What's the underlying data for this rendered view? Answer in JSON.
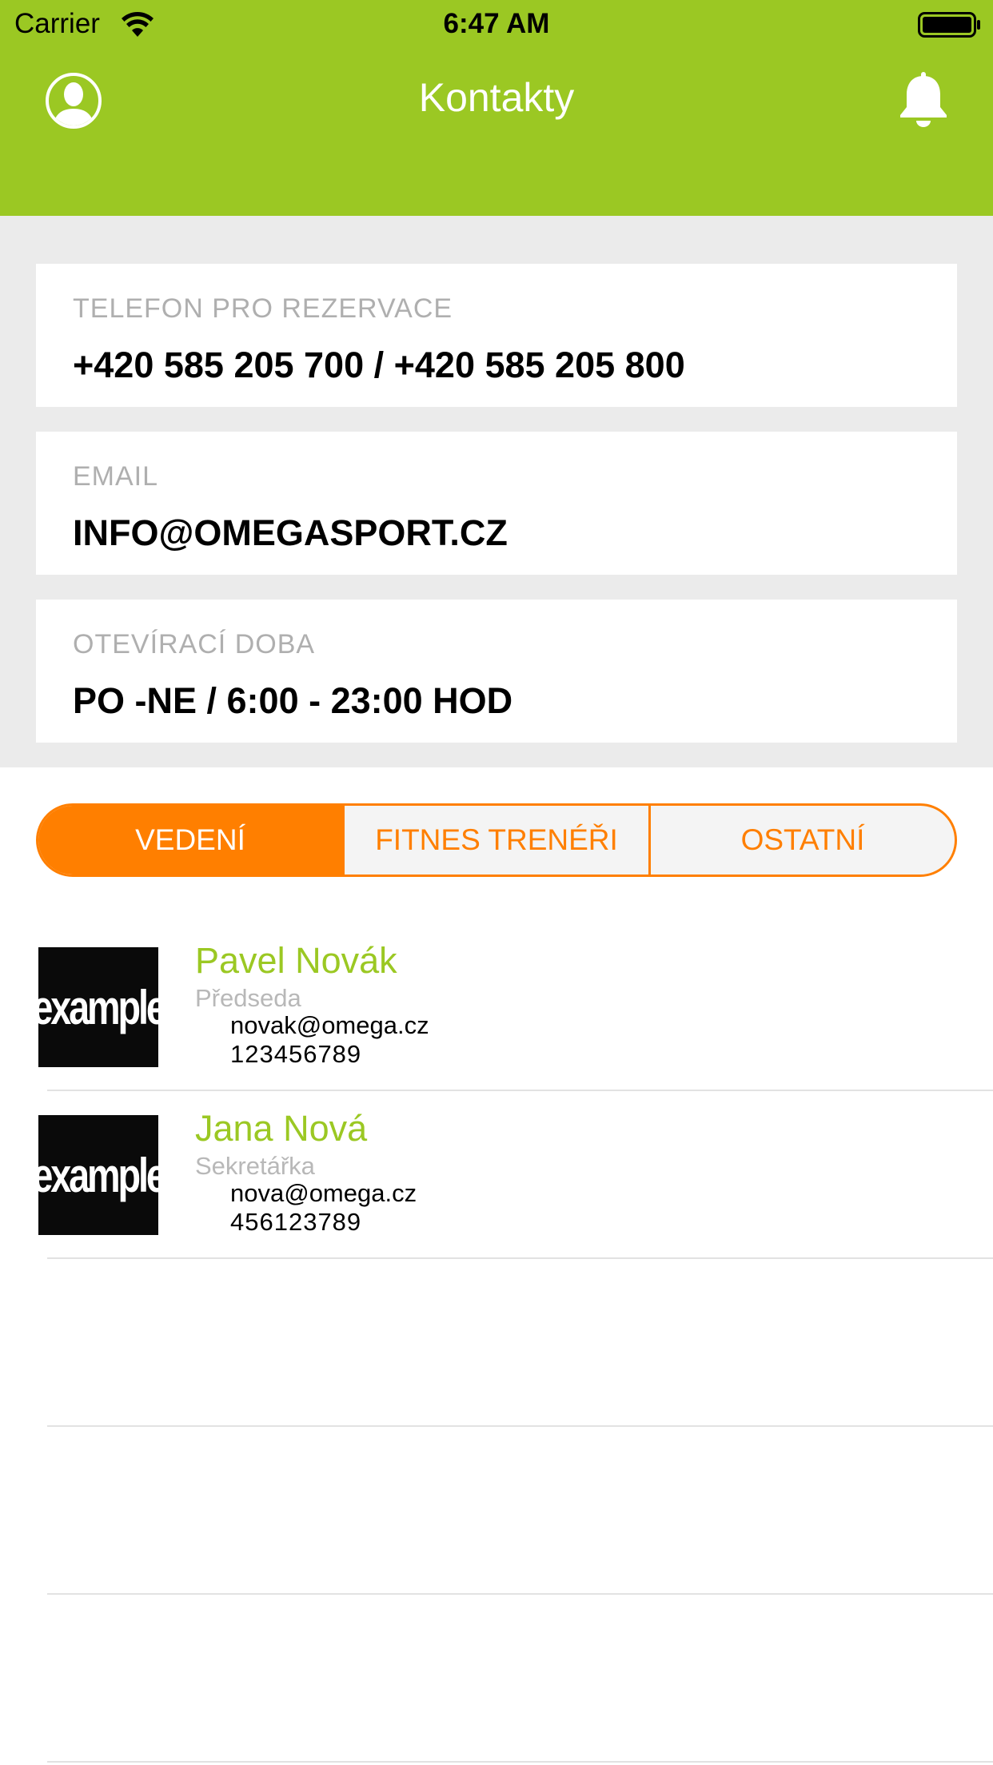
{
  "status_bar": {
    "carrier": "Carrier",
    "time": "6:47 AM"
  },
  "header": {
    "title": "Kontakty",
    "left_icon": "user-profile-icon",
    "right_icon": "bell-icon",
    "color": "#9BC823"
  },
  "info": {
    "phone": {
      "label": "TELEFON PRO REZERVACE",
      "value": "+420 585 205 700 / +420 585 205 800"
    },
    "email": {
      "label": "EMAIL",
      "value": "INFO@OMEGASPORT.CZ"
    },
    "hours": {
      "label": "OTEVÍRACÍ DOBA",
      "value": "PO -NE / 6:00 - 23:00 HOD"
    }
  },
  "tabs": {
    "accent_color": "#FF7F00",
    "selected": "VEDENÍ",
    "items": [
      {
        "label": "VEDENÍ"
      },
      {
        "label": "FITNES TRENÉŘI"
      },
      {
        "label": "OSTATNÍ"
      }
    ]
  },
  "contacts": [
    {
      "photo_text": "example",
      "name": "Pavel Novák",
      "role": "Předseda",
      "email": "novak@omega.cz",
      "phone": "123456789"
    },
    {
      "photo_text": "example",
      "name": "Jana Nová",
      "role": "Sekretářka",
      "email": "nova@omega.cz",
      "phone": "456123789"
    }
  ]
}
